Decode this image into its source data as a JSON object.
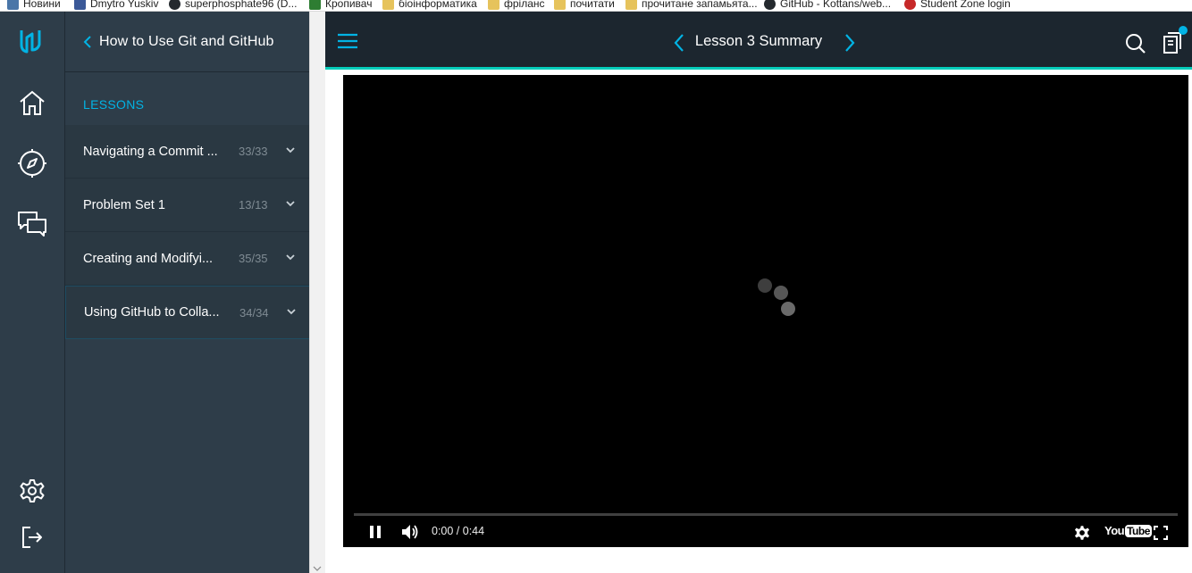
{
  "bookmarks": [
    {
      "label": "Новини",
      "color": "#4a76a8"
    },
    {
      "label": "Dmytro Yuskiv",
      "color": "#3b5998"
    },
    {
      "label": "superphosphate96 (D...",
      "color": "#24292e"
    },
    {
      "label": "Кропивач",
      "color": "#2e7d32"
    },
    {
      "label": "біоінформатика",
      "color": "#e6c35c"
    },
    {
      "label": "фріланс",
      "color": "#e6c35c"
    },
    {
      "label": "почитати",
      "color": "#e6c35c"
    },
    {
      "label": "прочитане запамьята...",
      "color": "#e6c35c"
    },
    {
      "label": "GitHub - Kottans/web...",
      "color": "#24292e"
    },
    {
      "label": "Student Zone login",
      "color": "#c62828"
    }
  ],
  "rail": {
    "icons": [
      "udacity-logo-icon",
      "home-icon",
      "compass-icon",
      "chat-icon",
      "settings-icon",
      "logout-icon"
    ]
  },
  "sidebar": {
    "back_icon": "chevron-left-icon",
    "title": "How to Use Git and GitHub",
    "section_label": "LESSONS",
    "lessons": [
      {
        "title": "Navigating a Commit ...",
        "count": "33/33"
      },
      {
        "title": "Problem Set 1",
        "count": "13/13"
      },
      {
        "title": "Creating and Modifyi...",
        "count": "35/35"
      },
      {
        "title": "Using GitHub to Colla...",
        "count": "34/34"
      }
    ]
  },
  "topnav": {
    "title": "Lesson 3 Summary",
    "accent": "#02b3e4",
    "underline": "#02ccba"
  },
  "video": {
    "time": "0:00 / 0:44",
    "progress": 0,
    "youtube_label": "You",
    "youtube_tube": "Tube"
  }
}
